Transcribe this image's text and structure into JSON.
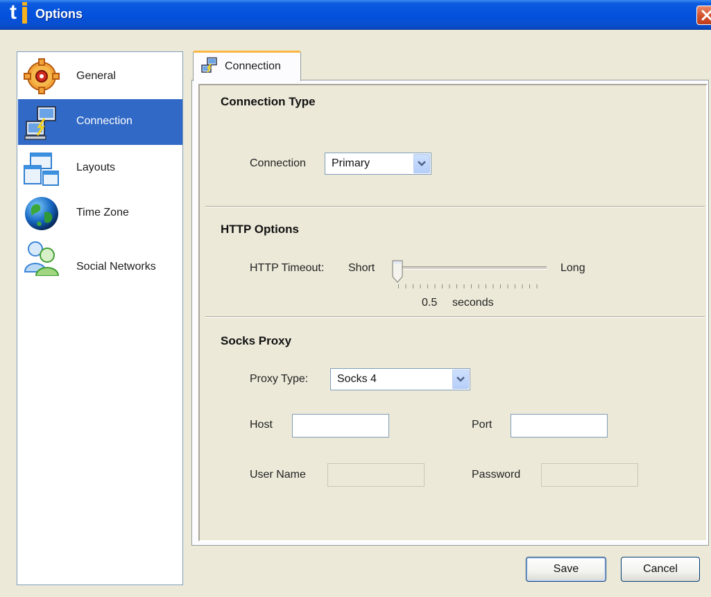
{
  "window": {
    "title": "Options",
    "logo_text": "t"
  },
  "sidebar": {
    "items": [
      {
        "label": "General",
        "icon": "gear-icon"
      },
      {
        "label": "Connection",
        "icon": "network-icon",
        "selected": true
      },
      {
        "label": "Layouts",
        "icon": "layout-icon"
      },
      {
        "label": "Time Zone",
        "icon": "globe-icon"
      },
      {
        "label": "Social Networks",
        "icon": "users-icon"
      }
    ]
  },
  "tab": {
    "label": "Connection"
  },
  "connection_type": {
    "heading": "Connection Type",
    "connection_label": "Connection",
    "connection_value": "Primary"
  },
  "http_options": {
    "heading": "HTTP Options",
    "timeout_label": "HTTP Timeout:",
    "short_label": "Short",
    "long_label": "Long",
    "value": "0.5",
    "unit": "seconds",
    "slider_level": 0
  },
  "socks_proxy": {
    "heading": "Socks Proxy",
    "proxy_type_label": "Proxy Type:",
    "proxy_type_value": "Socks 4",
    "host_label": "Host",
    "host_value": "",
    "port_label": "Port",
    "port_value": "",
    "username_label": "User Name",
    "username_value": "",
    "password_label": "Password",
    "password_value": ""
  },
  "buttons": {
    "save": "Save",
    "cancel": "Cancel"
  },
  "colors": {
    "titlebar": "#0351dd",
    "selection": "#3169c6",
    "tab_accent": "#f9b640",
    "window_bg": "#ece9d8"
  }
}
